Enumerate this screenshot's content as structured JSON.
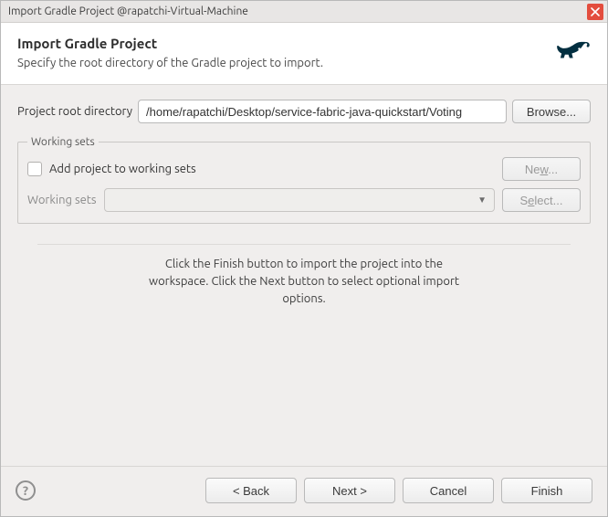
{
  "window": {
    "title": "Import Gradle Project @rapatchi-Virtual-Machine"
  },
  "header": {
    "title": "Import Gradle Project",
    "subtitle": "Specify the root directory of the Gradle project to import."
  },
  "form": {
    "root_dir_label": "Project root directory",
    "root_dir_value": "/home/rapatchi/Desktop/service-fabric-java-quickstart/Voting",
    "browse_label": "Browse..."
  },
  "working_sets": {
    "legend": "Working sets",
    "add_label": "Add project to working sets",
    "new_label_prefix": "Ne",
    "new_label_u": "w",
    "new_label_suffix": "...",
    "sets_label": "Working sets",
    "select_label_prefix": "S",
    "select_label_u": "e",
    "select_label_suffix": "lect..."
  },
  "instructions": {
    "line1": "Click the Finish button to import the project into the",
    "line2": "workspace. Click the Next button to select optional import",
    "line3": "options."
  },
  "footer": {
    "back": "< Back",
    "next": "Next >",
    "cancel": "Cancel",
    "finish": "Finish"
  }
}
